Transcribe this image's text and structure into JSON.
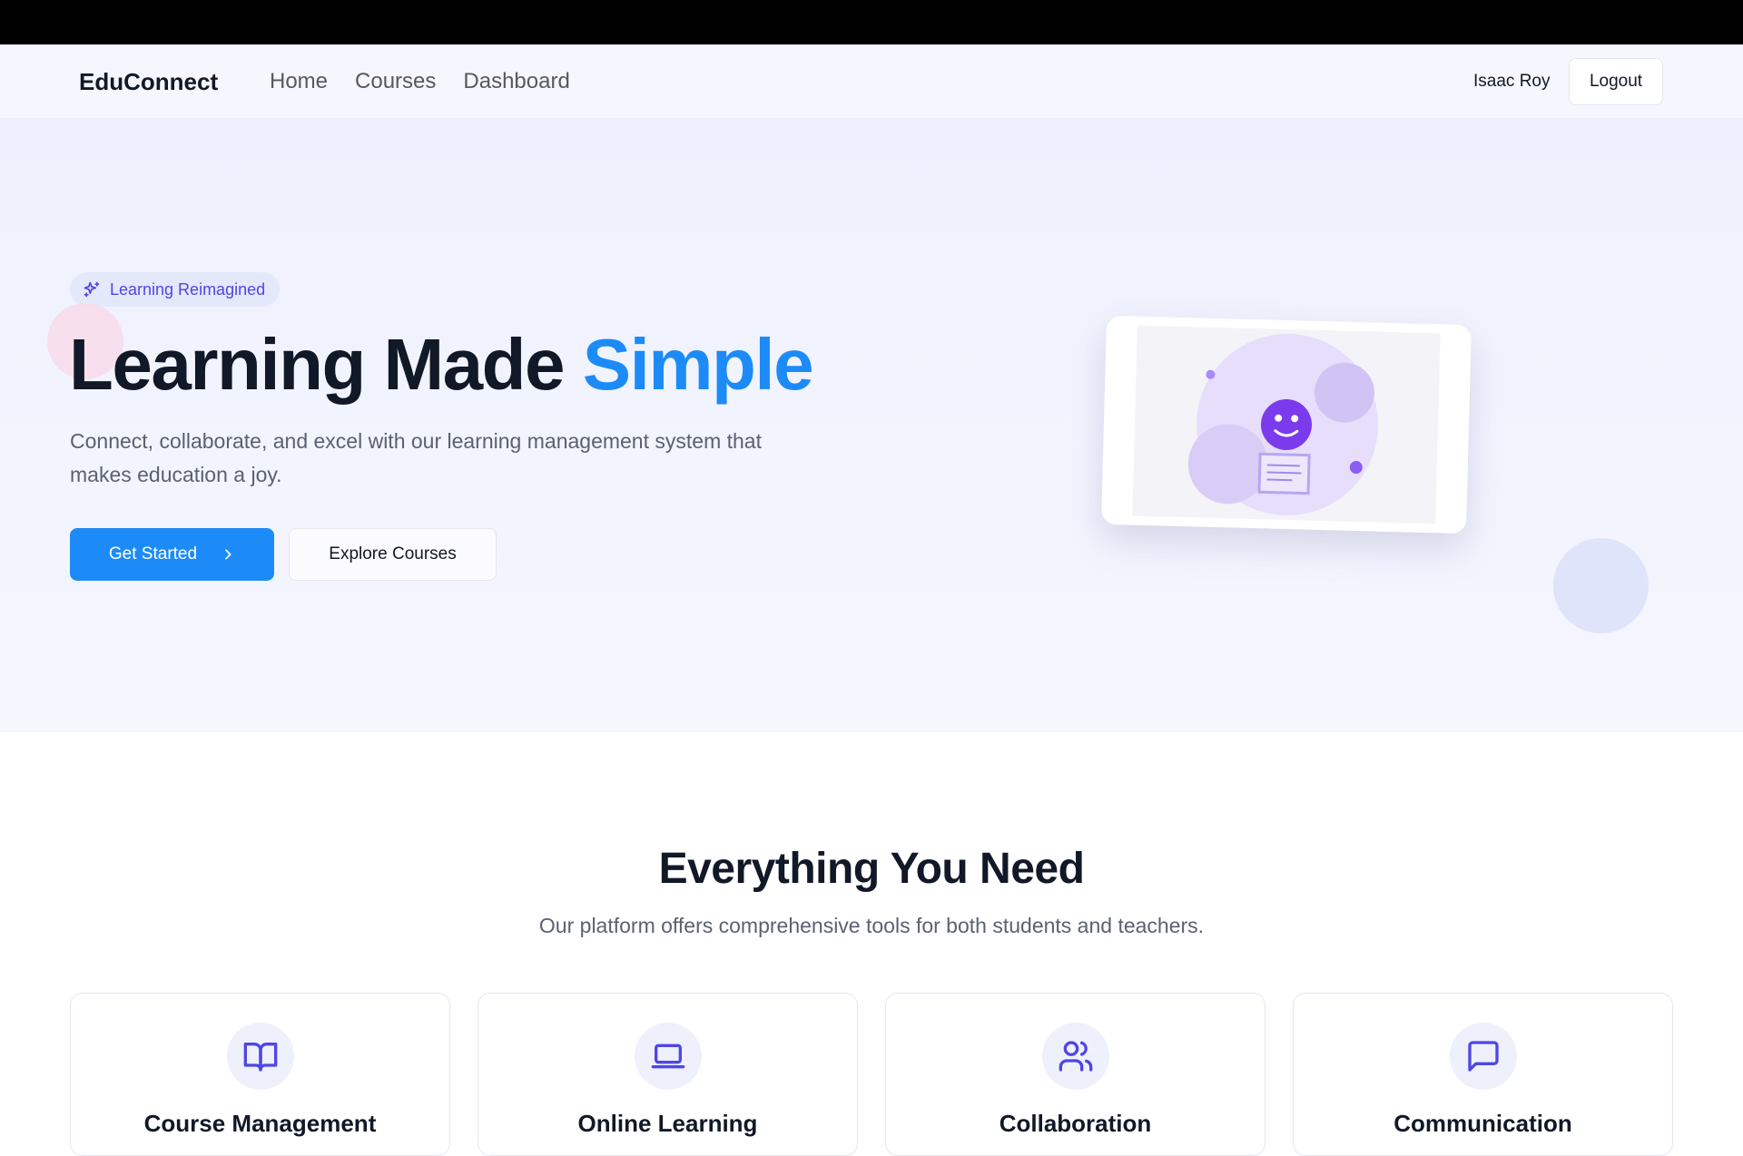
{
  "nav": {
    "brand": "EduConnect",
    "links": [
      {
        "label": "Home"
      },
      {
        "label": "Courses"
      },
      {
        "label": "Dashboard"
      }
    ],
    "user_name": "Isaac Roy",
    "logout_label": "Logout"
  },
  "hero": {
    "badge": "Learning Reimagined",
    "badge_icon": "sparkles-icon",
    "title_main": "Learning Made ",
    "title_accent": "Simple",
    "subtitle": "Connect, collaborate, and excel with our learning management system that makes education a joy.",
    "primary_cta": "Get Started",
    "secondary_cta": "Explore Courses"
  },
  "features": {
    "title": "Everything You Need",
    "subtitle": "Our platform offers comprehensive tools for both students and teachers.",
    "items": [
      {
        "title": "Course Management",
        "icon": "book-open-icon"
      },
      {
        "title": "Online Learning",
        "icon": "laptop-icon"
      },
      {
        "title": "Collaboration",
        "icon": "users-icon"
      },
      {
        "title": "Communication",
        "icon": "message-square-icon"
      }
    ]
  },
  "colors": {
    "primary": "#1c8bf8",
    "accent_purple": "#7c3aed",
    "badge_text": "#4f46e5",
    "hero_bg": "#eef1fd",
    "icon_color": "#4f46e5"
  }
}
